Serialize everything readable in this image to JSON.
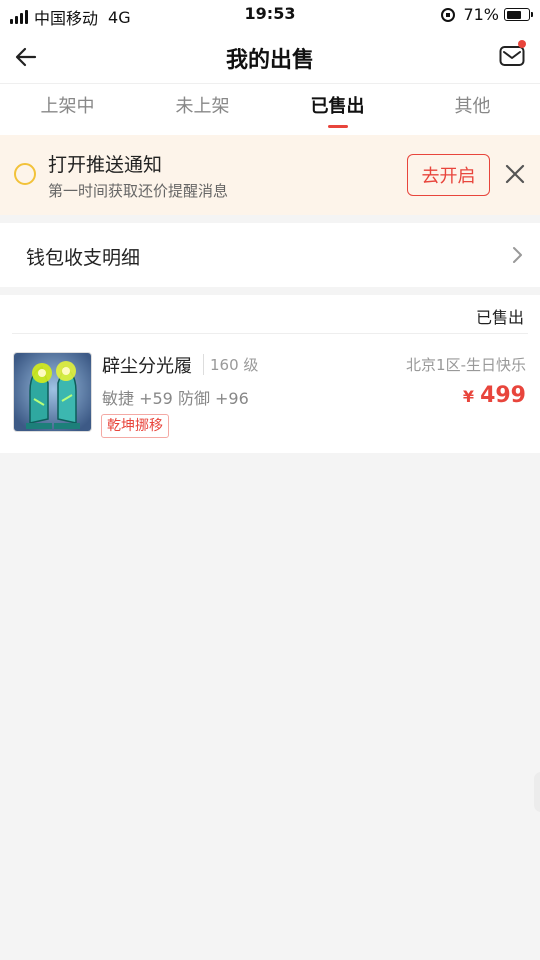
{
  "status_bar": {
    "carrier": "中国移动",
    "network": "4G",
    "time": "19:53",
    "battery": "71%",
    "battery_level": 0.71
  },
  "header": {
    "title": "我的出售",
    "back_icon": "back-arrow-icon",
    "mail_icon": "mail-icon",
    "accent_color": "#e8453c"
  },
  "tabs": [
    {
      "label": "上架中",
      "active": false
    },
    {
      "label": "未上架",
      "active": false
    },
    {
      "label": "已售出",
      "active": true
    },
    {
      "label": "其他",
      "active": false
    }
  ],
  "notice": {
    "title": "打开推送通知",
    "subtitle": "第一时间获取还价提醒消息",
    "button_label": "去开启",
    "background": "#fdf4ea"
  },
  "wallet": {
    "label": "钱包收支明细"
  },
  "sold_item": {
    "status": "已售出",
    "name": "辟尘分光履",
    "level": "160 级",
    "server": "北京1区-生日快乐",
    "stats": "敏捷 +59 防御 +96",
    "currency": "¥",
    "price": "499",
    "tag": "乾坤挪移"
  }
}
